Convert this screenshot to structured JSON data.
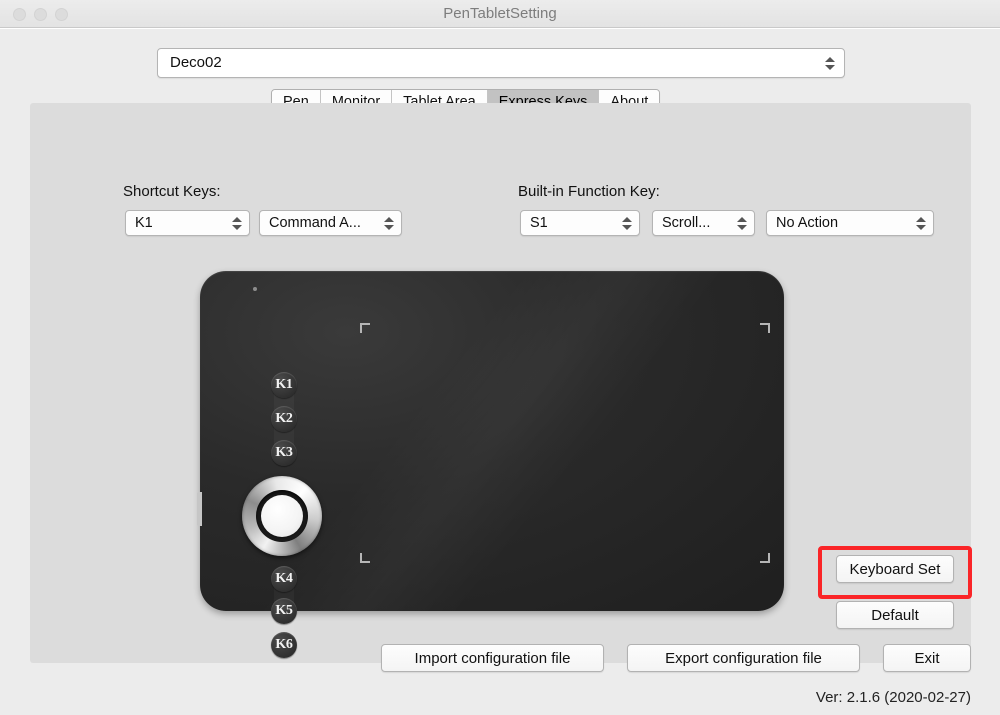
{
  "window": {
    "title": "PenTabletSetting",
    "traffic_lights": [
      "close",
      "minimize",
      "zoom"
    ]
  },
  "device_selector": {
    "value": "Deco02"
  },
  "tabs": [
    {
      "label": "Pen",
      "active": false
    },
    {
      "label": "Monitor",
      "active": false
    },
    {
      "label": "Tablet Area",
      "active": false
    },
    {
      "label": "Express Keys",
      "active": true
    },
    {
      "label": "About",
      "active": false
    }
  ],
  "shortcut_keys": {
    "label": "Shortcut Keys:",
    "key_select": "K1",
    "action_select": "Command  A..."
  },
  "builtin_function_key": {
    "label": "Built-in Function Key:",
    "key_select": "S1",
    "mode_select": "Scroll...",
    "action_select": "No Action"
  },
  "tablet": {
    "express_keys": [
      "K1",
      "K2",
      "K3",
      "K4",
      "K5",
      "K6"
    ],
    "ring_dial": "ring-dial",
    "led_indicator": "led-indicator",
    "side_button": "side-button",
    "active_area_corners": [
      "top-left",
      "top-right",
      "bottom-left",
      "bottom-right"
    ]
  },
  "side_buttons": {
    "keyboard_set": "Keyboard Set",
    "default": "Default"
  },
  "highlight": {
    "target": "keyboard_set",
    "color": "#fa2528"
  },
  "bottom_buttons": {
    "import": "Import configuration file",
    "export": "Export configuration file",
    "exit": "Exit"
  },
  "version": "Ver: 2.1.6 (2020-02-27)",
  "colors": {
    "window_chrome": "#ececec",
    "panel": "#dcdcdc",
    "tablet_body": "#2a2a2a",
    "accent_highlight": "#fa2528",
    "active_tab": "#c2c2c2"
  }
}
